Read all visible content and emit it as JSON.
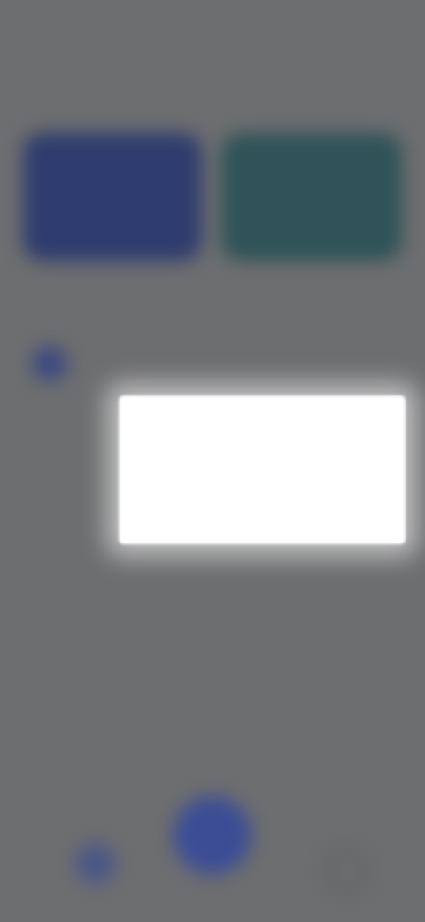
{
  "status_bar": {
    "time": "",
    "icons": ""
  },
  "header": {
    "title": "",
    "action": ""
  },
  "cards": [
    {
      "label": "",
      "value": "",
      "color": "#2f3c6e"
    },
    {
      "label": "",
      "value": "",
      "color": "#2f5358"
    }
  ],
  "section": {
    "title": "",
    "link": ""
  },
  "list": [
    {
      "text": ""
    }
  ],
  "popup_menu": {
    "items": [
      {
        "label": ""
      },
      {
        "label": ""
      },
      {
        "label": ""
      }
    ]
  },
  "bottom_nav": {
    "home_icon": "home-icon",
    "fab_icon": "plus-icon",
    "profile_icon": "profile-icon"
  },
  "colors": {
    "accent": "#3c4d96",
    "overlay": "#6d6e70",
    "popup_bg": "#ffffff"
  }
}
